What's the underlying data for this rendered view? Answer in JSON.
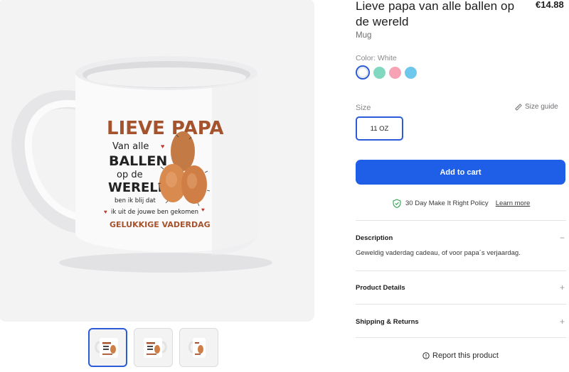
{
  "product": {
    "title": "Lieve papa van alle ballen op de wereld",
    "price": "€14.88",
    "type": "Mug",
    "color_label": "Color: White",
    "swatches": [
      {
        "name": "White",
        "hex": "#ffffff"
      },
      {
        "name": "Mint",
        "hex": "#7fd8bf"
      },
      {
        "name": "Pink",
        "hex": "#f6a3b5"
      },
      {
        "name": "Light Blue",
        "hex": "#6ec8ec"
      }
    ],
    "size_label": "Size",
    "size_guide_label": "Size guide",
    "size_option": "11 OZ",
    "add_to_cart": "Add to cart",
    "policy_text": "30 Day Make It Right Policy",
    "policy_link": "Learn more"
  },
  "mug_print": {
    "line1": "LIEVE PAPA",
    "line2": "Van alle",
    "line3": "BALLEN",
    "line4": "op de",
    "line5": "WERELD",
    "line6": "ben ik blij dat",
    "line7": "ik uit de jouwe ben gekomen",
    "line8": "GELUKKIGE VADERDAG"
  },
  "accordion": {
    "description": {
      "title": "Description",
      "sign": "−",
      "body": "Geweldig vaderdag cadeau, of voor papa´s verjaardag."
    },
    "details": {
      "title": "Product Details",
      "sign": "+"
    },
    "shipping": {
      "title": "Shipping & Returns",
      "sign": "+"
    }
  },
  "report_label": "Report this product",
  "colors": {
    "accent": "#1f5fe8",
    "print_brown": "#a5532d"
  }
}
